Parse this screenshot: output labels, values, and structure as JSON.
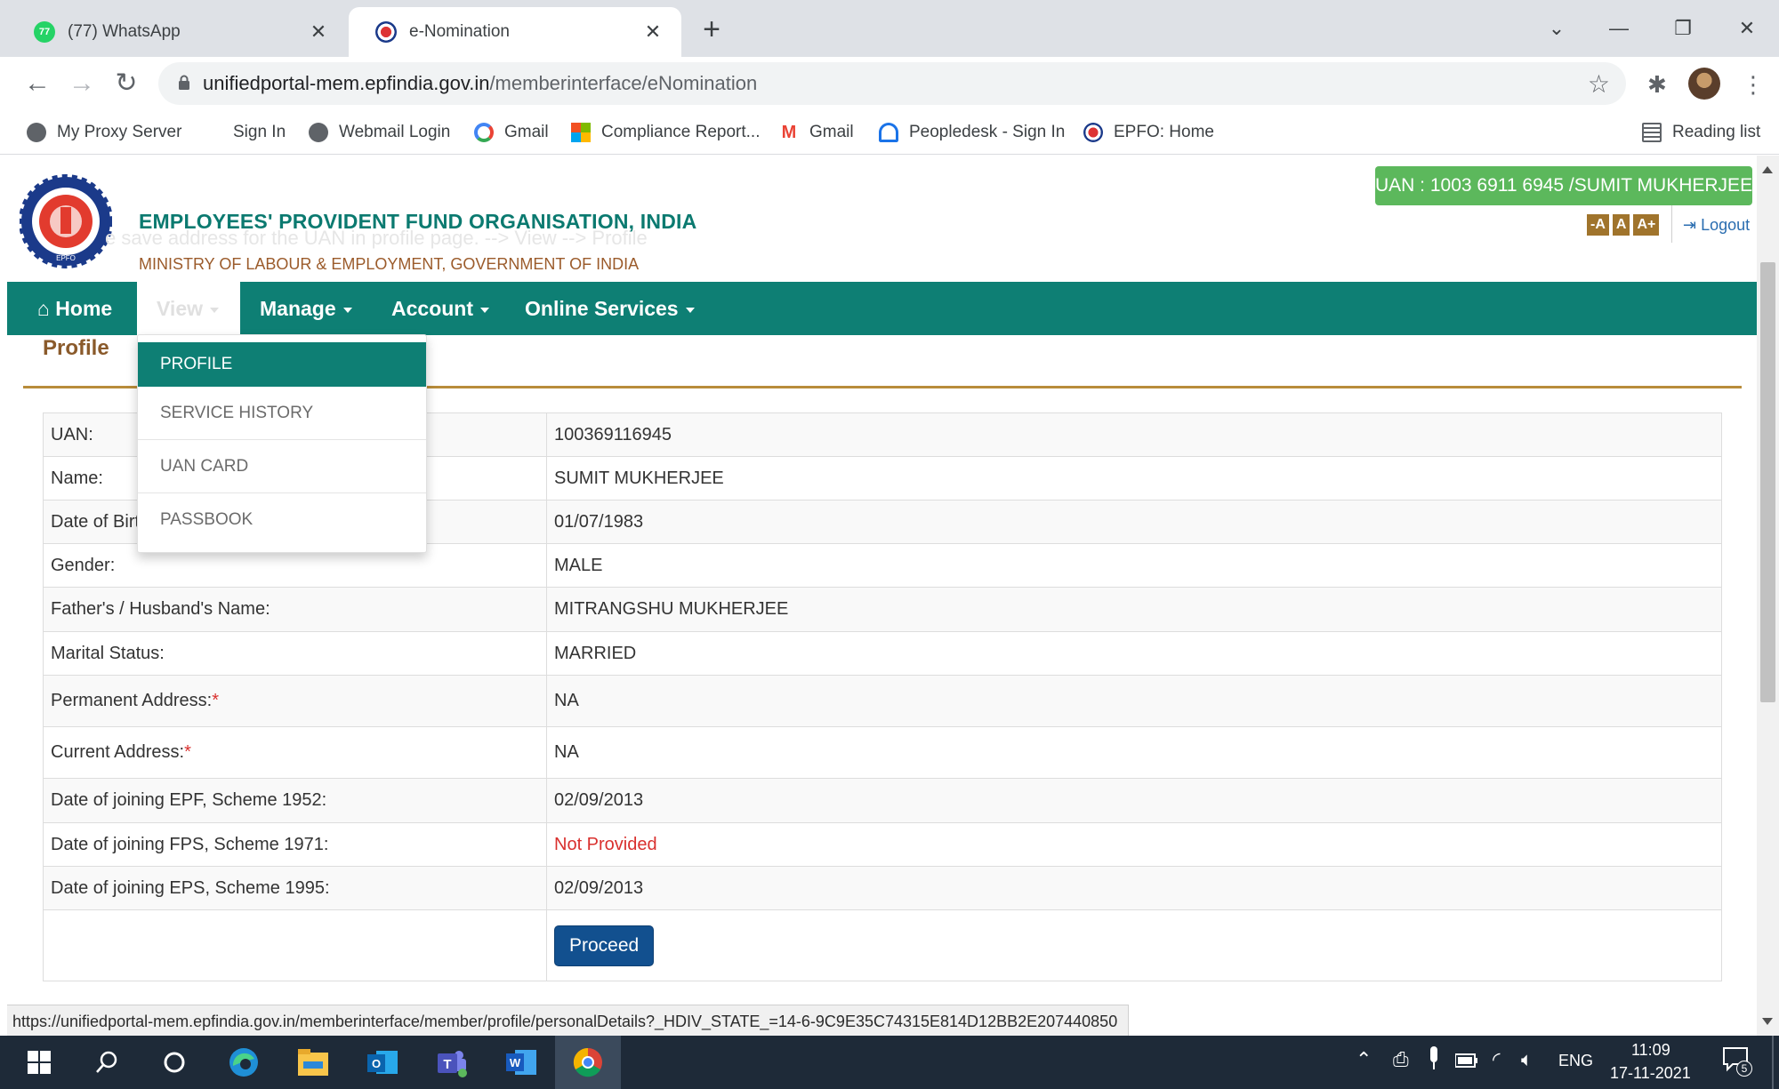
{
  "browser": {
    "tabs": [
      {
        "title": "(77) WhatsApp",
        "badge": "77",
        "active": false
      },
      {
        "title": "e-Nomination",
        "active": true
      }
    ],
    "new_tab_symbol": "+",
    "url_host": "unifiedportal-mem.epfindia.gov.in",
    "url_path": "/memberinterface/eNomination",
    "bookmarks": [
      {
        "label": "My Proxy Server",
        "icon": "globe-icon"
      },
      {
        "label": "Sign In",
        "icon": "none"
      },
      {
        "label": "Webmail Login",
        "icon": "globe-icon"
      },
      {
        "label": "Gmail",
        "icon": "google-icon"
      },
      {
        "label": "Compliance Report...",
        "icon": "microsoft-icon"
      },
      {
        "label": "Gmail",
        "icon": "gmail-icon"
      },
      {
        "label": "Peopledesk - Sign In",
        "icon": "peopledesk-icon"
      },
      {
        "label": "EPFO: Home",
        "icon": "epfo-icon"
      }
    ],
    "reading_list": "Reading list",
    "status_url": "https://unifiedportal-mem.epfindia.gov.in/memberinterface/member/profile/personalDetails?_HDIV_STATE_=14-6-9C9E35C74315E814D12BB2E207440850"
  },
  "header": {
    "org_name": "EMPLOYEES' PROVIDENT FUND ORGANISATION, INDIA",
    "ghost_text": "e save address for the UAN in profile page. --> View --> Profile",
    "ministry": "MINISTRY OF LABOUR & EMPLOYMENT, GOVERNMENT OF INDIA",
    "uan_badge": "UAN : 1003 6911 6945 /SUMIT MUKHERJEE",
    "font_buttons": [
      "-A",
      "A",
      "A+"
    ],
    "logout": "Logout"
  },
  "menu": {
    "home": "Home",
    "view": "View",
    "manage": "Manage",
    "account": "Account",
    "online_services": "Online Services"
  },
  "dropdown": [
    "PROFILE",
    "SERVICE HISTORY",
    "UAN CARD",
    "PASSBOOK"
  ],
  "section_title": "Profile",
  "profile": [
    {
      "label": "UAN:",
      "value": "100369116945"
    },
    {
      "label": "Name:",
      "value": "SUMIT MUKHERJEE"
    },
    {
      "label": "Date of Birth:",
      "value": "01/07/1983"
    },
    {
      "label": "Gender:",
      "value": "MALE"
    },
    {
      "label": "Father's / Husband's Name:",
      "value": "MITRANGSHU MUKHERJEE"
    },
    {
      "label": "Marital Status:",
      "value": "MARRIED"
    },
    {
      "label": "Permanent Address:",
      "required": "*",
      "value": "NA"
    },
    {
      "label": "Current Address:",
      "required": "*",
      "value": "NA"
    },
    {
      "label": "Date of joining EPF, Scheme 1952:",
      "value": "02/09/2013"
    },
    {
      "label": "Date of joining FPS, Scheme 1971:",
      "value": "Not Provided"
    },
    {
      "label": "Date of joining EPS, Scheme 1995:",
      "value": "02/09/2013"
    }
  ],
  "proceed_label": "Proceed",
  "colors": {
    "teal": "#0e7f74",
    "badge_green": "#5cb85c",
    "not_provided_red": "#d9302e",
    "proceed_blue": "#12508f"
  },
  "taskbar": {
    "language": "ENG",
    "time": "11:09",
    "date": "17-11-2021",
    "notifications": "5"
  }
}
